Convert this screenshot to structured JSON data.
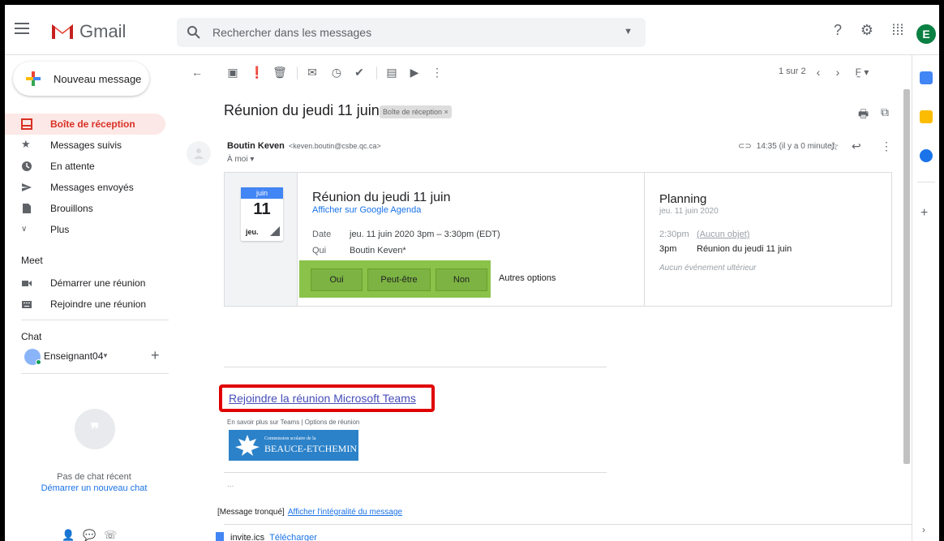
{
  "app": {
    "name": "Gmail",
    "avatar_letter": "E"
  },
  "search": {
    "placeholder": "Rechercher dans les messages"
  },
  "compose": {
    "label": "Nouveau message"
  },
  "sidebar": {
    "items": [
      {
        "label": "Boîte de réception",
        "icon": "inbox-icon",
        "active": true
      },
      {
        "label": "Messages suivis",
        "icon": "star-icon"
      },
      {
        "label": "En attente",
        "icon": "clock-icon"
      },
      {
        "label": "Messages envoyés",
        "icon": "send-icon"
      },
      {
        "label": "Brouillons",
        "icon": "draft-icon"
      },
      {
        "label": "Plus",
        "icon": "chevron-down-icon"
      }
    ],
    "meet_title": "Meet",
    "meet_items": [
      {
        "label": "Démarrer une réunion",
        "icon": "video-icon"
      },
      {
        "label": "Rejoindre une réunion",
        "icon": "keyboard-icon"
      }
    ],
    "chat_title": "Chat",
    "chat_user": "Enseignant04",
    "no_chat": "Pas de chat récent",
    "new_chat": "Démarrer un nouveau chat"
  },
  "toolbar": {
    "pager": "1 sur 2",
    "lang_label": "F̰ ▾"
  },
  "message": {
    "subject": "Réunion du jeudi 11 juin",
    "label_chip": "Boîte de réception ×",
    "sender_name": "Boutin Keven",
    "sender_email": "<keven.boutin@csbe.qc.ca>",
    "to": "À moi ▾",
    "time": "14:35 (il y a 0 minute)"
  },
  "invite": {
    "cal_month": "juin",
    "cal_day": "11",
    "cal_weekday": "jeu.",
    "title": "Réunion du jeudi 11 juin",
    "gcal_link": "Afficher sur Google Agenda",
    "date_label": "Date",
    "date_value": "jeu. 11 juin 2020 3pm – 3:30pm (EDT)",
    "who_label": "Qui",
    "who_value": "Boutin Keven*",
    "rsvp": [
      "Oui",
      "Peut-être",
      "Non"
    ],
    "other_options": "Autres options"
  },
  "planning": {
    "title": "Planning",
    "date": "jeu. 11 juin 2020",
    "rows": [
      {
        "time": "2:30pm",
        "value": "(Aucun objet)"
      },
      {
        "time": "3pm",
        "value": "Réunion du jeudi 11 juin"
      }
    ],
    "none": "Aucun événement ultérieur"
  },
  "body": {
    "teams_link": "Rejoindre la réunion Microsoft Teams",
    "learn_more": "En savoir plus sur Teams | Options de réunion",
    "logo_line1": "Commission scolaire de la",
    "logo_line2": "BEAUCE-ETCHEMIN",
    "ellipsis": "...",
    "truncated": "[Message tronqué]",
    "show_full": "Afficher l'intégralité du message",
    "attachment": "invite.ics",
    "download": "Télécharger"
  },
  "colors": {
    "accent_red": "#d93025",
    "rsvp_highlight": "#8bc34a",
    "teams_box": "#e00000",
    "link_blue": "#1a73e8"
  }
}
